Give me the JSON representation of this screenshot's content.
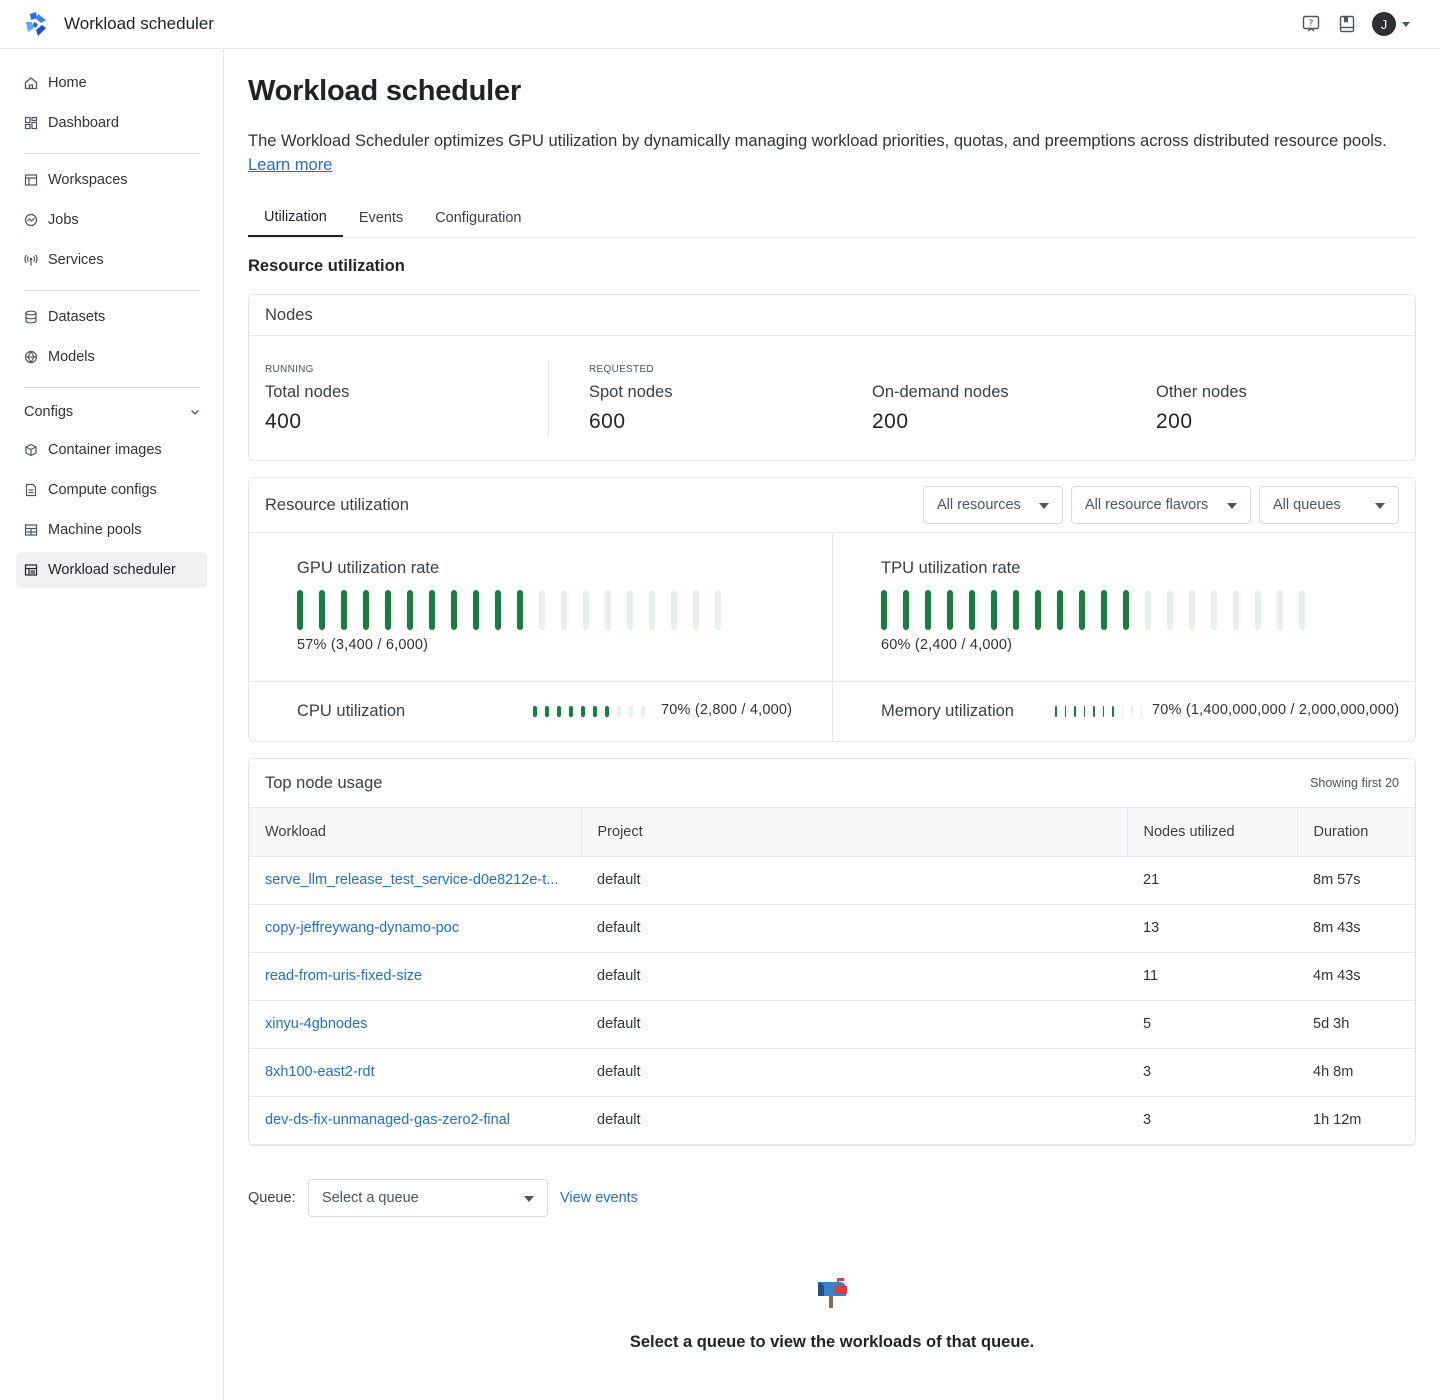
{
  "app": {
    "title": "Workload scheduler",
    "avatar_initial": "J"
  },
  "sidebar": {
    "items": [
      {
        "label": "Home",
        "icon": "home-icon"
      },
      {
        "label": "Dashboard",
        "icon": "dashboard-icon"
      },
      {
        "label": "Workspaces",
        "icon": "workspace-icon"
      },
      {
        "label": "Jobs",
        "icon": "jobs-icon"
      },
      {
        "label": "Services",
        "icon": "services-icon"
      },
      {
        "label": "Datasets",
        "icon": "database-icon"
      },
      {
        "label": "Models",
        "icon": "models-icon"
      },
      {
        "label": "Container images",
        "icon": "cube-icon"
      },
      {
        "label": "Compute configs",
        "icon": "file-icon"
      },
      {
        "label": "Machine pools",
        "icon": "machine-pool-icon"
      },
      {
        "label": "Workload scheduler",
        "icon": "scheduler-icon"
      }
    ],
    "group_label": "Configs"
  },
  "page": {
    "title": "Workload scheduler",
    "description": "The Workload Scheduler optimizes GPU utilization by dynamically managing workload priorities, quotas, and preemptions across distributed resource pools.",
    "learn_more": "Learn more",
    "tabs": [
      "Utilization",
      "Events",
      "Configuration"
    ],
    "section_title": "Resource utilization"
  },
  "nodes": {
    "title": "Nodes",
    "stats": [
      {
        "kicker": "RUNNING",
        "label": "Total nodes",
        "value": "400"
      },
      {
        "kicker": "REQUESTED",
        "label": "Spot nodes",
        "value": "600"
      },
      {
        "kicker": "",
        "label": "On-demand nodes",
        "value": "200"
      },
      {
        "kicker": "",
        "label": "Other nodes",
        "value": "200"
      }
    ]
  },
  "utilization": {
    "title": "Resource utilization",
    "filters": [
      "All resources",
      "All resource flavors",
      "All queues"
    ],
    "gpu": {
      "title": "GPU utilization rate",
      "text": "57% (3,400 / 6,000)",
      "fraction": 0.57
    },
    "tpu": {
      "title": "TPU utilization rate",
      "text": "60% (2,400 / 4,000)",
      "fraction": 0.6
    },
    "cpu": {
      "title": "CPU utilization",
      "text": "70% (2,800 / 4,000)",
      "fraction": 0.7
    },
    "memory": {
      "title": "Memory utilization",
      "text": "70% (1,400,000,000 / 2,000,000,000)",
      "fraction": 0.7
    },
    "colors": {
      "filled": "#15803d",
      "empty": "#e6f2e8"
    }
  },
  "top_nodes": {
    "title": "Top node usage",
    "showing": "Showing first 20",
    "columns": [
      "Workload",
      "Project",
      "Nodes utilized",
      "Duration"
    ],
    "rows": [
      [
        "serve_llm_release_test_service-d0e8212e-t...",
        "default",
        "21",
        "8m 57s"
      ],
      [
        "copy-jeffreywang-dynamo-poc",
        "default",
        "13",
        "8m 43s"
      ],
      [
        "read-from-uris-fixed-size",
        "default",
        "11",
        "4m 43s"
      ],
      [
        "xinyu-4gbnodes",
        "default",
        "5",
        "5d 3h"
      ],
      [
        "8xh100-east2-rdt",
        "default",
        "3",
        "4h 8m"
      ],
      [
        "dev-ds-fix-unmanaged-gas-zero2-final",
        "default",
        "3",
        "1h 12m"
      ]
    ]
  },
  "queue": {
    "label": "Queue:",
    "placeholder": "Select a queue",
    "view_events": "View events",
    "empty_text": "Select a queue to view the workloads of that queue.",
    "empty_icon": "mailbox-icon"
  }
}
